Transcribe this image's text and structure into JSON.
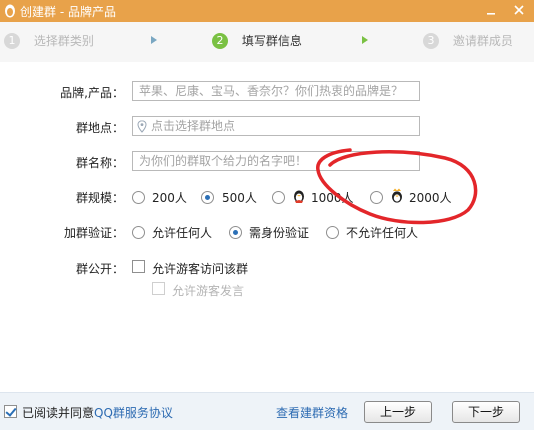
{
  "window": {
    "title": "创建群 - 品牌产品",
    "minimize_icon": "minimize-icon",
    "close_icon": "close-icon"
  },
  "steps": [
    {
      "number": "1",
      "label": "选择群类别"
    },
    {
      "number": "2",
      "label": "填写群信息"
    },
    {
      "number": "3",
      "label": "邀请群成员"
    }
  ],
  "form": {
    "brand_label": "品牌,产品：",
    "brand_placeholder": "苹果、尼康、宝马、香奈尔？你们热衷的品牌是？",
    "location_label": "群地点：",
    "location_placeholder": "点击选择群地点",
    "name_label": "群名称：",
    "name_placeholder": "为你们的群取个给力的名字吧！",
    "size_label": "群规模：",
    "size_options": [
      "200人",
      "500人",
      "1000人",
      "2000人"
    ],
    "size_selected": "500人",
    "verify_label": "加群验证：",
    "verify_options": [
      "允许任何人",
      "需身份验证",
      "不允许任何人"
    ],
    "verify_selected": "需身份验证",
    "public_label": "群公开：",
    "public_option_1": "允许游客访问该群",
    "public_option_2": "允许游客发言"
  },
  "footer": {
    "agree_prefix": "已阅读并同意",
    "agree_link": "QQ群服务协议",
    "check_link": "查看建群资格",
    "prev_button": "上一步",
    "next_button": "下一步"
  },
  "colors": {
    "titlebar": "#e8a24a",
    "active_step": "#7ac143",
    "link": "#2d6bb2",
    "annotation": "#e3262a"
  }
}
